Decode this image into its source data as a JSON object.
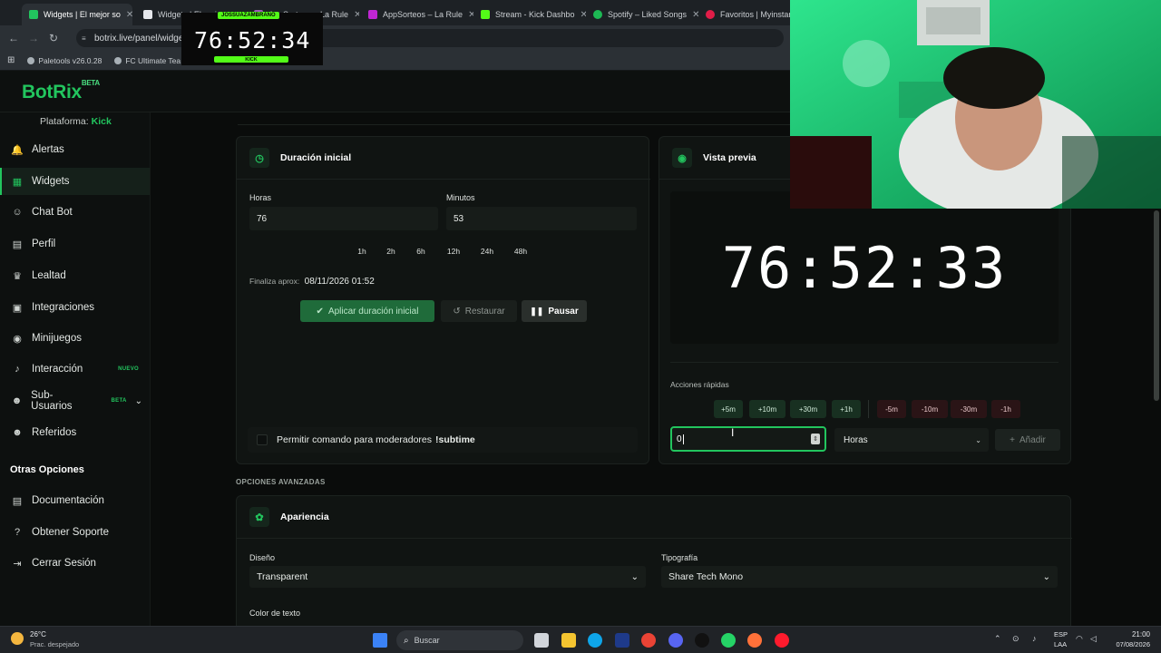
{
  "browser": {
    "tabs": [
      {
        "label": "Widgets | El mejor so",
        "fav": "#22c55e"
      },
      {
        "label": "Widgets | El mejor",
        "fav": "#22c55e"
      },
      {
        "label": "AppSorteos – La Rule",
        "fav": "#9b59b6"
      },
      {
        "label": "AppSorteos – La Rule",
        "fav": "#c026d3"
      },
      {
        "label": "Stream - Kick Dashbo",
        "fav": "#53fc18"
      },
      {
        "label": "Spotify – Liked Songs",
        "fav": "#1db954"
      },
      {
        "label": "Favoritos | Myinstants",
        "fav": "#e11d48"
      }
    ],
    "url": "botrix.live/panel/widge",
    "bookmarks": [
      "Paletools v26.0.28",
      "FC Ultimate Tea"
    ]
  },
  "overlay_timer": {
    "value": "76:52:34",
    "tag_top": "JOSSUAZAMBRANO",
    "tag_bottom": "KICK"
  },
  "app": {
    "logo": "BotRix",
    "logo_sup": "BETA",
    "platform_label": "Plataforma:",
    "platform_value": "Kick"
  },
  "sidebar": {
    "items": [
      {
        "label": "Alertas",
        "icon": "bell-icon",
        "glyph": "🔔"
      },
      {
        "label": "Widgets",
        "icon": "grid-icon",
        "glyph": "▦"
      },
      {
        "label": "Chat Bot",
        "icon": "robot-icon",
        "glyph": "☺"
      },
      {
        "label": "Perfil",
        "icon": "id-card-icon",
        "glyph": "▤"
      },
      {
        "label": "Lealtad",
        "icon": "trophy-icon",
        "glyph": "♛"
      },
      {
        "label": "Integraciones",
        "icon": "puzzle-icon",
        "glyph": "▣"
      },
      {
        "label": "Minijuegos",
        "icon": "gamepad-icon",
        "glyph": "◉"
      },
      {
        "label": "Interacción",
        "icon": "music-icon",
        "glyph": "♪",
        "badge": "NUEVO",
        "badge_color": "#22c55e"
      },
      {
        "label": "Sub-Usuarios",
        "icon": "users-icon",
        "glyph": "☻",
        "badge": "BETA",
        "badge_color": "#22c55e"
      },
      {
        "label": "Referidos",
        "icon": "people-icon",
        "glyph": "☻"
      }
    ],
    "other_title": "Otras Opciones",
    "other_items": [
      {
        "label": "Documentación",
        "icon": "book-icon",
        "glyph": "▤"
      },
      {
        "label": "Obtener Soporte",
        "icon": "help-icon",
        "glyph": "?"
      },
      {
        "label": "Cerrar Sesión",
        "icon": "logout-icon",
        "glyph": "⇥"
      }
    ]
  },
  "duration_card": {
    "title": "Duración inicial",
    "hours_label": "Horas",
    "hours_value": "76",
    "minutes_label": "Minutos",
    "minutes_value": "53",
    "chips": [
      "1h",
      "2h",
      "6h",
      "12h",
      "24h",
      "48h"
    ],
    "ends_label": "Finaliza aprox:",
    "ends_value": "08/11/2026 01:52",
    "apply_label": "Aplicar duración inicial",
    "restore_label": "Restaurar",
    "pause_label": "Pausar",
    "mod_label": "Permitir comando para moderadores",
    "mod_cmd": "!subtime"
  },
  "preview_card": {
    "title": "Vista previa",
    "timer": "76:52:33",
    "quick_label": "Acciones rápidas",
    "plus": [
      "+5m",
      "+10m",
      "+30m",
      "+1h"
    ],
    "minus": [
      "-5m",
      "-10m",
      "-30m",
      "-1h"
    ],
    "amount_value": "0",
    "unit_value": "Horas",
    "add_label": "Añadir"
  },
  "advanced": {
    "section_label": "OPCIONES AVANZADAS",
    "title": "Apariencia",
    "design_label": "Diseño",
    "design_value": "Transparent",
    "font_label": "Tipografía",
    "font_value": "Share Tech Mono",
    "color_label": "Color de texto"
  },
  "taskbar": {
    "weather_temp": "26°C",
    "weather_desc": "Prac. despejado",
    "search_placeholder": "Buscar",
    "lang": "ESP",
    "lang2": "LAA",
    "time": "21:00",
    "date": "07/08/2026"
  }
}
